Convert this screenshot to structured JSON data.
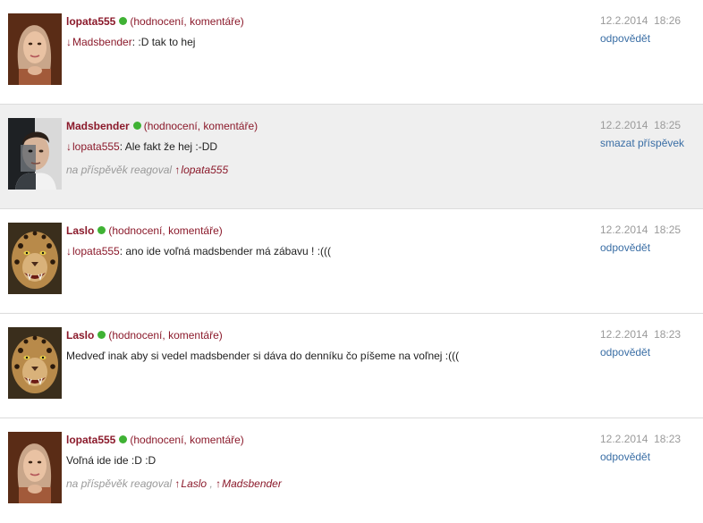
{
  "posts": [
    {
      "username": "lopata555",
      "rating_link": "hodnocení",
      "comments_link": "komentáře",
      "reply_to": "Madsbender",
      "text": ": :D tak to hej",
      "date": "12.2.2014",
      "time": "18:26",
      "action": "odpovědět"
    },
    {
      "username": "Madsbender",
      "rating_link": "hodnocení",
      "comments_link": "komentáře",
      "reply_to": "lopata555",
      "text": ": Ale fakt že hej :-DD",
      "reacted_label": "na příspěvěk reagoval",
      "reacted_users": [
        "lopata555"
      ],
      "date": "12.2.2014",
      "time": "18:25",
      "action": "smazat příspěvek"
    },
    {
      "username": "Laslo",
      "rating_link": "hodnocení",
      "comments_link": "komentáře",
      "reply_to": "lopata555",
      "text": ": ano ide voľná madsbender má zábavu ! :(((",
      "date": "12.2.2014",
      "time": "18:25",
      "action": "odpovědět"
    },
    {
      "username": "Laslo",
      "rating_link": "hodnocení",
      "comments_link": "komentáře",
      "text": "Medveď inak aby si vedel madsbender si dáva do denníku čo píšeme na voľnej :(((",
      "date": "12.2.2014",
      "time": "18:23",
      "action": "odpovědět"
    },
    {
      "username": "lopata555",
      "rating_link": "hodnocení",
      "comments_link": "komentáře",
      "text": "Voľná ide ide :D :D",
      "reacted_label": "na příspěvěk reagoval",
      "reacted_users": [
        "Laslo",
        "Madsbender"
      ],
      "reacted_separator": " , ",
      "date": "12.2.2014",
      "time": "18:23",
      "action": "odpovědět"
    }
  ],
  "icons": {
    "online": "online-status-dot",
    "reply_down_arrow": "↓",
    "reacted_up_arrow": "↑"
  },
  "colors": {
    "username": "#8b1a2b",
    "online": "#3fb234",
    "action_link": "#3a6ea5",
    "date": "#9a9a9a",
    "highlight_row": "#efefef"
  }
}
